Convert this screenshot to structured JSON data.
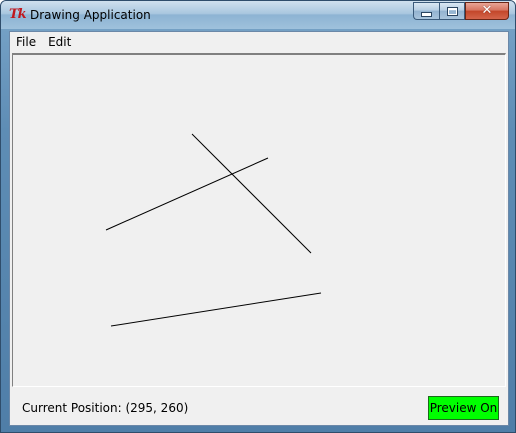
{
  "window": {
    "title": "Drawing Application",
    "icon": "tk-feather-icon",
    "icon_text": "Tk",
    "caption_buttons": {
      "minimize": "minimize-icon",
      "maximize": "maximize-icon",
      "close": "close-icon"
    }
  },
  "menubar": {
    "items": [
      {
        "label": "File"
      },
      {
        "label": "Edit"
      }
    ]
  },
  "canvas": {
    "background": "#f0f0f0",
    "line_color": "#000000"
  },
  "status": {
    "position_text": "Current Position: (295, 260)"
  },
  "preview_button": {
    "label": "Preview On",
    "color": "#00ff00"
  }
}
